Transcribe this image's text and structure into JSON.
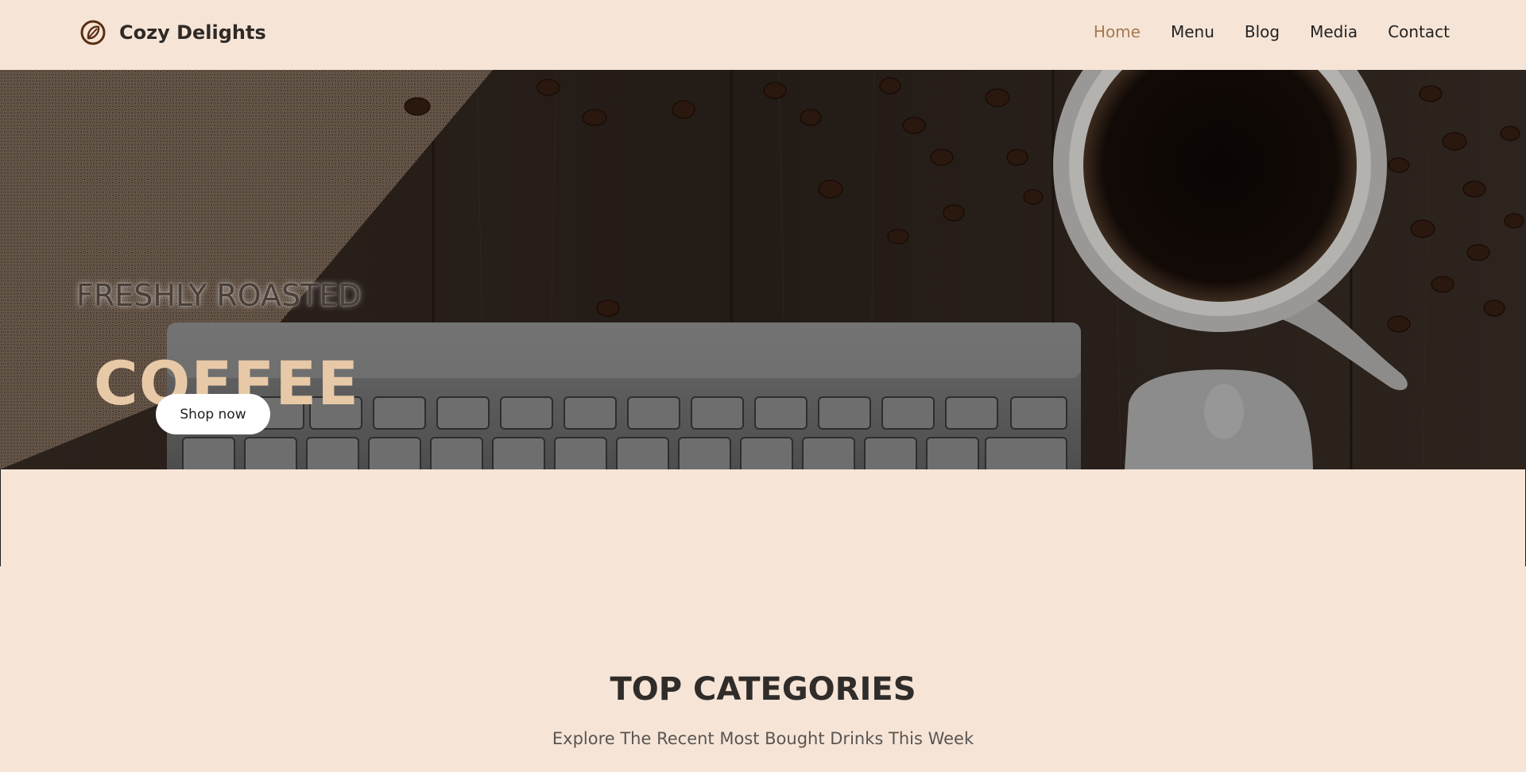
{
  "brand": {
    "name": "Cozy Delights",
    "icon": "coffee-bean-icon"
  },
  "nav": {
    "items": [
      {
        "label": "Home",
        "active": true
      },
      {
        "label": "Menu",
        "active": false
      },
      {
        "label": "Blog",
        "active": false
      },
      {
        "label": "Media",
        "active": false
      },
      {
        "label": "Contact",
        "active": false
      }
    ]
  },
  "hero": {
    "kicker": "FRESHLY ROASTED",
    "title": "COFFEE",
    "button_label": "Shop now",
    "image": "coffee-keyboard-table-photo"
  },
  "categories": {
    "title": "TOP CATEGORIES",
    "subtitle": "Explore The Recent Most Bought Drinks This Week"
  },
  "colors": {
    "page_bg": "#f6e5d7",
    "accent": "#a57a52",
    "hero_title": "#e8c9a7"
  }
}
